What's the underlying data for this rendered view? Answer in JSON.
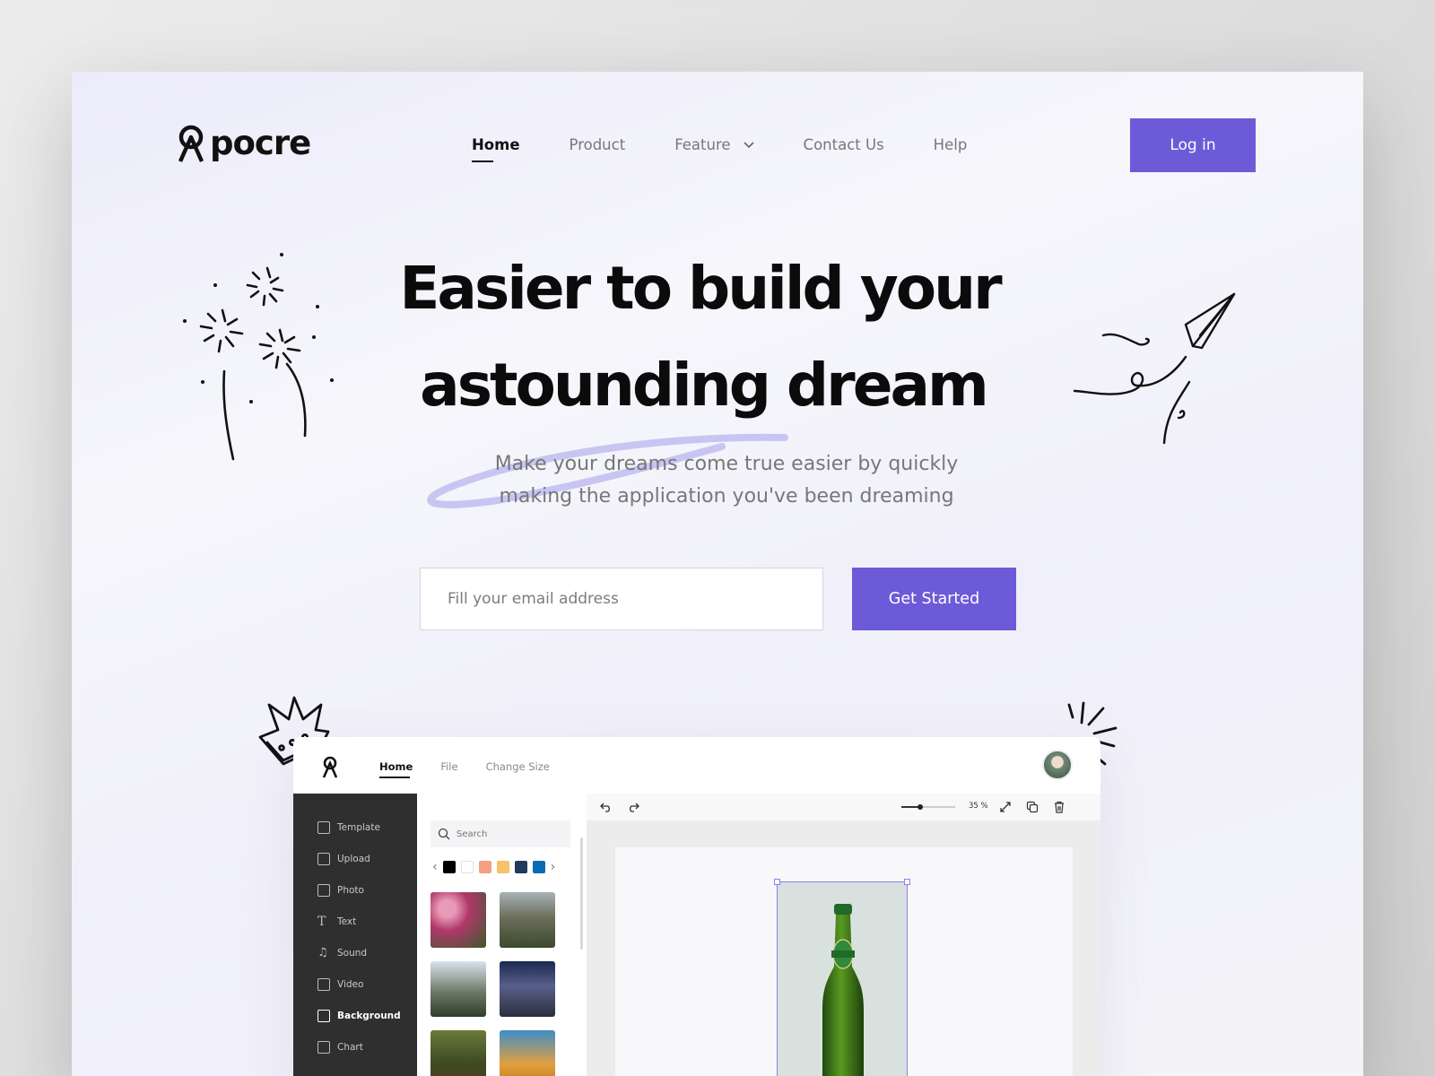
{
  "brand": {
    "name": "pocre"
  },
  "nav": {
    "items": [
      {
        "label": "Home",
        "active": true
      },
      {
        "label": "Product"
      },
      {
        "label": "Feature",
        "has_dropdown": true
      },
      {
        "label": "Contact Us"
      },
      {
        "label": "Help"
      }
    ],
    "login_label": "Log in"
  },
  "hero": {
    "line1": "Easier to build your",
    "line2": "astounding dream",
    "subtitle_line1": "Make your dreams come true easier by quickly",
    "subtitle_line2": "making the application you've been dreaming",
    "email_placeholder": "Fill your email address",
    "cta_label": "Get Started"
  },
  "app": {
    "nav": [
      {
        "label": "Home",
        "active": true
      },
      {
        "label": "File"
      },
      {
        "label": "Change Size"
      }
    ],
    "sidebar": [
      {
        "label": "Template",
        "icon": "template-icon"
      },
      {
        "label": "Upload",
        "icon": "upload-icon"
      },
      {
        "label": "Photo",
        "icon": "photo-icon"
      },
      {
        "label": "Text",
        "icon": "text-icon"
      },
      {
        "label": "Sound",
        "icon": "sound-icon"
      },
      {
        "label": "Video",
        "icon": "video-icon"
      },
      {
        "label": "Background",
        "icon": "background-icon",
        "active": true
      },
      {
        "label": "Chart",
        "icon": "chart-icon"
      }
    ],
    "search_placeholder": "Search",
    "swatch_colors": [
      "#000000",
      "#ffffff",
      "#f3a081",
      "#f8c26a",
      "#1f3a5f",
      "#0a6bb4"
    ],
    "zoom_label": "35 %",
    "zoom_level": 0.35
  },
  "colors": {
    "accent": "#6c5ad8",
    "sidebar": "#2f2f2f"
  }
}
